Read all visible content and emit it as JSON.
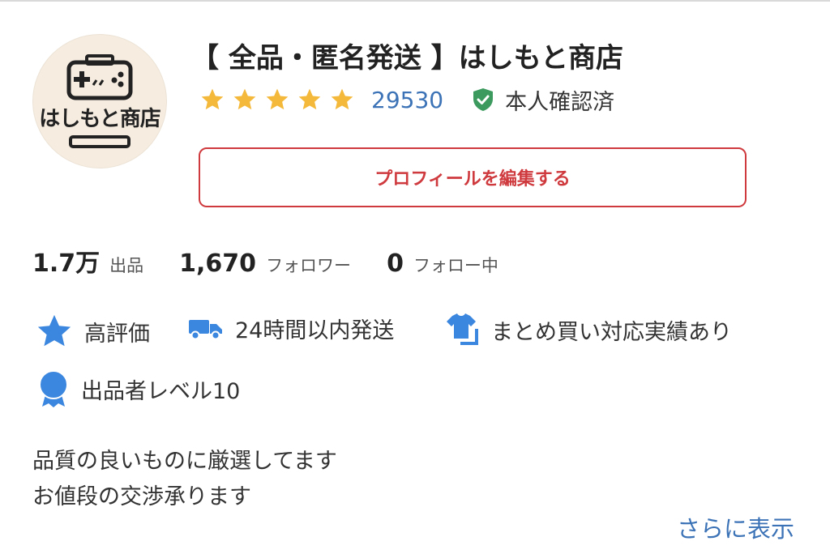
{
  "shop": {
    "avatar_text": "はしもと商店",
    "name": "【 全品・匿名発送 】はしもと商店",
    "rating": 5,
    "review_count": "29530",
    "verified_label": "本人確認済"
  },
  "edit_button_label": "プロフィールを編集する",
  "stats": [
    {
      "value": "1.7万",
      "label": "出品"
    },
    {
      "value": "1,670",
      "label": "フォロワー"
    },
    {
      "value": "0",
      "label": "フォロー中"
    }
  ],
  "badges": [
    {
      "label": "高評価",
      "icon": "star-icon"
    },
    {
      "label": "24時間以内発送",
      "icon": "truck-icon"
    },
    {
      "label": "まとめ買い対応実績あり",
      "icon": "shirt-icon"
    },
    {
      "label": "出品者レベル10",
      "icon": "medal-icon"
    }
  ],
  "description": [
    "品質の良いものに厳選してます",
    "お値段の交渉承ります"
  ],
  "more_link": "さらに表示",
  "colors": {
    "accent_red": "#cf3a3e",
    "link_blue": "#3c73b7",
    "star_gold": "#f4b93a",
    "badge_blue": "#3b86de",
    "verified_green": "#3d9a5e"
  }
}
